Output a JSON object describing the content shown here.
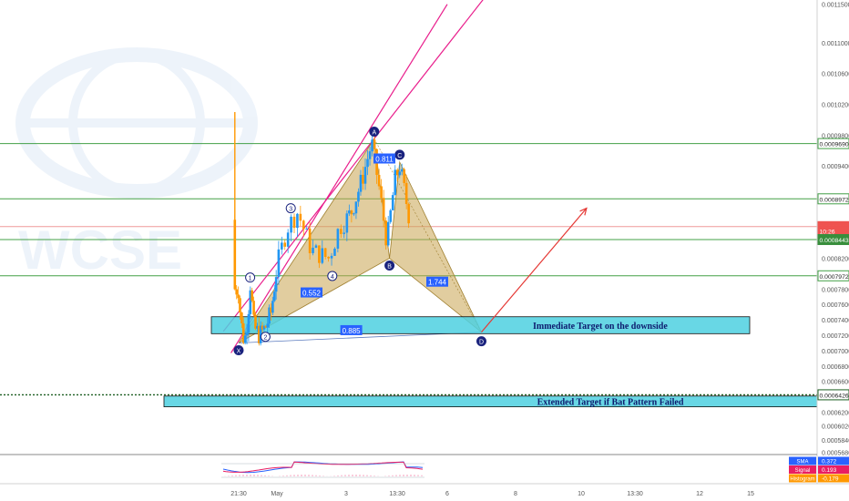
{
  "chart_data": {
    "type": "candlestick",
    "symbol_watermark": "WCSE",
    "y_axis": {
      "labels": [
        "0.0011500",
        "0.0011000",
        "0.0010600",
        "0.0010200",
        "0.0009800",
        "0.0009400",
        "0.0008200",
        "0.0007800",
        "0.0007600",
        "0.0007400",
        "0.0007200",
        "0.0007000",
        "0.0006800",
        "0.0006600",
        "0.0006200",
        "0.0006020",
        "0.0005840",
        "0.0005680"
      ],
      "values": [
        0.00115,
        0.0011,
        0.00106,
        0.00102,
        0.00098,
        0.00094,
        0.00082,
        0.00078,
        0.00076,
        0.00074,
        0.00072,
        0.0007,
        0.00068,
        0.00066,
        0.00062,
        0.000602,
        0.000584,
        0.000568
      ],
      "ylim": [
        0.000565,
        0.0011555
      ]
    },
    "x_axis": {
      "labels": [
        "21:30",
        "May",
        "3",
        "13:30",
        "6",
        "8",
        "10",
        "13:30",
        "12",
        "15"
      ],
      "positions": [
        0.0,
        1.0,
        2.0,
        3.0,
        4.0,
        5.0,
        6.0,
        7.0,
        8.0,
        9.0
      ]
    },
    "price_markers": [
      {
        "label": "0.0009690",
        "value": 0.000969,
        "color": "#43a047",
        "style": "outline"
      },
      {
        "label": "0.0008972",
        "value": 0.0008972,
        "color": "#43a047",
        "style": "outline"
      },
      {
        "label": "0.0008611",
        "value": 0.0008611,
        "color": "#ef5350",
        "style": "filled"
      },
      {
        "label": "10:26",
        "value": 0.0008555,
        "color": "#ef5350",
        "style": "filled-time"
      },
      {
        "label": "0.0008443",
        "value": 0.0008443,
        "color": "#388e3c",
        "style": "filled"
      },
      {
        "label": "0.0007972",
        "value": 0.0007972,
        "color": "#43a047",
        "style": "outline"
      },
      {
        "label": "0.0006426",
        "value": 0.0006426,
        "color": "#1b5e20",
        "style": "outline"
      }
    ],
    "horizontal_lines": [
      {
        "value": 0.000969,
        "color": "#43a047",
        "dashed": false
      },
      {
        "value": 0.0008972,
        "color": "#43a047",
        "dashed": false
      },
      {
        "value": 0.0008611,
        "color": "#ef9a9a",
        "dashed": false
      },
      {
        "value": 0.0008443,
        "color": "#43a047",
        "dashed": false
      },
      {
        "value": 0.0007972,
        "color": "#43a047",
        "dashed": false
      },
      {
        "value": 0.0006426,
        "color": "#1b5e20",
        "dashed": true
      }
    ],
    "pattern_points": [
      {
        "label": "X",
        "x": 0.0,
        "y": 0.00071
      },
      {
        "label": "A",
        "x": 2.55,
        "y": 0.000975
      },
      {
        "label": "B",
        "x": 2.85,
        "y": 0.00082
      },
      {
        "label": "C",
        "x": 3.05,
        "y": 0.000945
      },
      {
        "label": "D",
        "x": 4.5,
        "y": 0.000724
      }
    ],
    "wave_points": [
      {
        "label": "1",
        "x": 0.3,
        "y": 0.000795
      },
      {
        "label": "2",
        "x": 0.7,
        "y": 0.000718
      },
      {
        "label": "3",
        "x": 1.2,
        "y": 0.000885
      },
      {
        "label": "4",
        "x": 1.8,
        "y": 0.000797
      }
    ],
    "ratios": [
      {
        "label": "0.811",
        "x": 2.75,
        "y": 0.000949
      },
      {
        "label": "0.552",
        "x": 1.5,
        "y": 0.000775
      },
      {
        "label": "1.744",
        "x": 3.8,
        "y": 0.000789
      },
      {
        "label": "0.885",
        "x": 2.1,
        "y": 0.000726
      }
    ],
    "targets": [
      {
        "label": "Immediate Target on the downside",
        "top": 0.000744,
        "bottom": 0.000722
      },
      {
        "label": "Extended Target if Bat Pattern Failed",
        "top": 0.000641,
        "bottom": 0.000627
      }
    ],
    "projection_arrow": {
      "from": [
        4.5,
        0.000724
      ],
      "to": [
        6.1,
        0.000885
      ]
    },
    "channel": {
      "lower": [
        [
          -0.2,
          0.000697
        ],
        [
          4.0,
          0.00115
        ]
      ],
      "upper": [
        [
          -0.4,
          0.000725
        ],
        [
          5.0,
          0.00121
        ]
      ]
    },
    "indicator": {
      "legend": [
        {
          "name": "SMA",
          "value": "0.372",
          "color": "#2962ff"
        },
        {
          "name": "Signal",
          "value": "0.193",
          "color": "#e91e63"
        },
        {
          "name": "Histogram",
          "value": "-0.179",
          "color": "#ff9800"
        }
      ]
    },
    "colors": {
      "up": "#2196f3",
      "down": "#ff9800",
      "pattern_fill": "#c8a450",
      "channel": "#e91e8c",
      "target_fill": "#4dd0e1",
      "arrow": "#e53935"
    }
  }
}
